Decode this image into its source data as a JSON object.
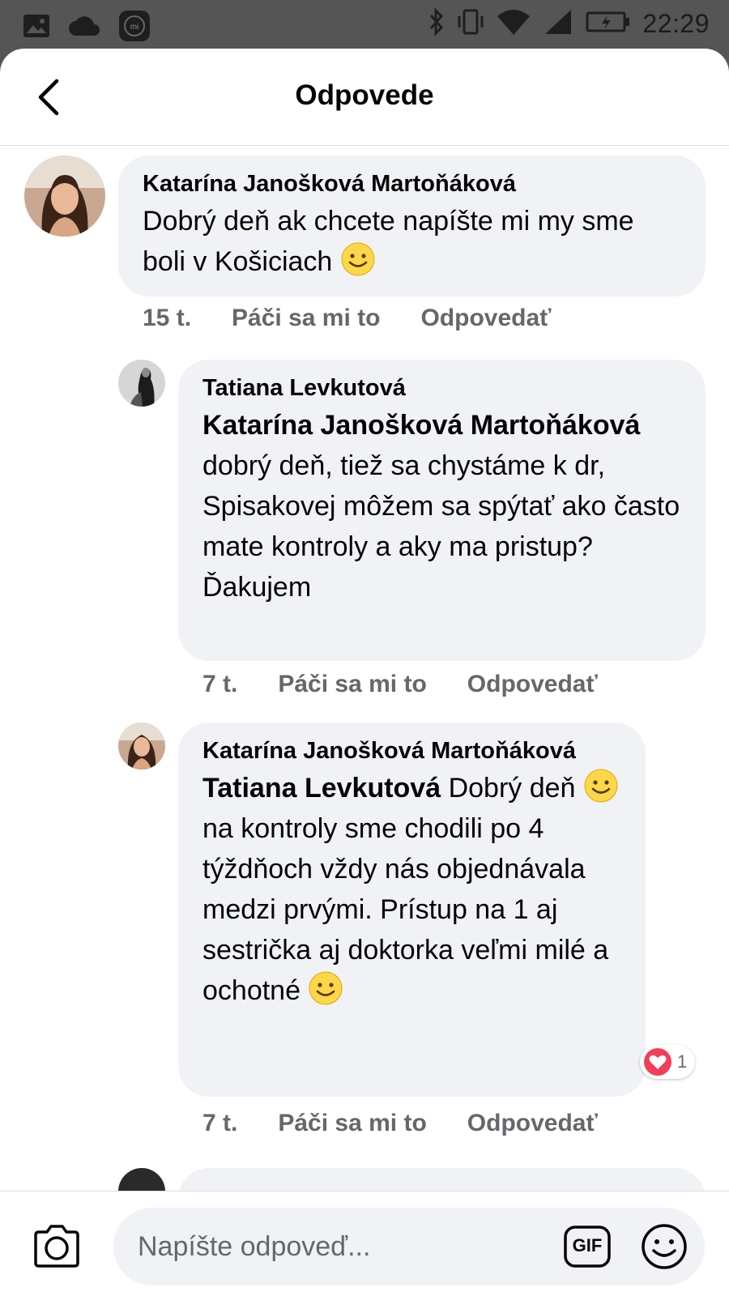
{
  "status_bar": {
    "time": "22:29",
    "icons": [
      "gallery-icon",
      "cloud-icon",
      "mi-icon",
      "bluetooth-icon",
      "vibrate-icon",
      "wifi-icon",
      "signal-icon",
      "battery-icon"
    ]
  },
  "header": {
    "title": "Odpovede",
    "back_icon": "chevron-left-icon"
  },
  "comments": [
    {
      "author": "Katarína Janošková Martoňáková",
      "text_before": "Dobrý deň ak chcete napíšte mi my sme boli v Košiciach",
      "emoji": "slightly-smiling-face",
      "time": "15 t.",
      "like_label": "Páči sa mi to",
      "reply_label": "Odpovedať"
    },
    {
      "author": "Tatiana Levkutová",
      "mention": "Katarína Janošková Martoňáková",
      "text": " dobrý deň, tiež sa chystáme k dr, Spisakovej môžem sa spýtať ako často mate kontroly a aky ma pristup? Ďakujem",
      "time": "7 t.",
      "like_label": "Páči sa mi to",
      "reply_label": "Odpovedať"
    },
    {
      "author": "Katarína Janošková Martoňáková",
      "mention": "Tatiana Levkutová",
      "text_1": " Dobrý deň",
      "text_2": " na kontroly sme chodili po 4 týždňoch vždy nás objednávala medzi prvými. Prístup na 1 aj sestrička aj doktorka veľmi milé a ochotné",
      "time": "7 t.",
      "like_label": "Páči sa mi to",
      "reply_label": "Odpovedať",
      "reaction": {
        "type": "love",
        "count": "1"
      }
    }
  ],
  "composer": {
    "placeholder": "Napíšte odpoveď...",
    "gif_label": "GIF",
    "camera_icon": "camera-icon",
    "emoji_icon": "smiley-icon"
  },
  "colors": {
    "bubble": "#f0f2f5",
    "secondary_text": "#65676b",
    "love_red": "#f33e58",
    "statusbar_bg": "#555555"
  }
}
